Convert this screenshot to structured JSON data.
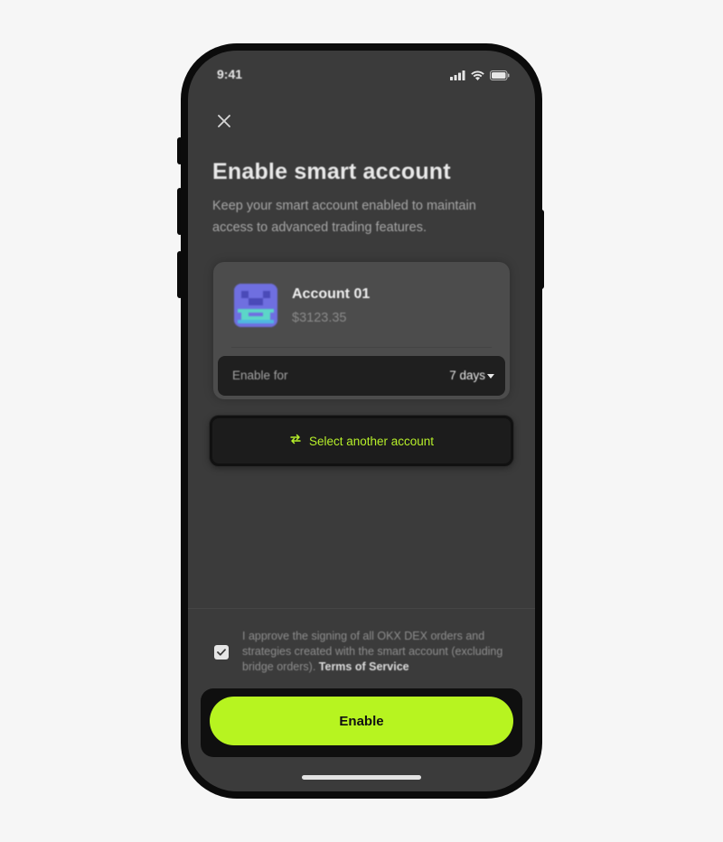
{
  "status_bar": {
    "time": "9:41"
  },
  "header": {
    "title": "Enable smart account",
    "subtitle": "Keep your smart account enabled to maintain access to advanced trading features."
  },
  "account": {
    "name": "Account 01",
    "balance": "$3123.35",
    "enable_for_label": "Enable for",
    "enable_for_value": "7 days"
  },
  "select_another": {
    "label": "Select another account"
  },
  "consent": {
    "checked": true,
    "text": "I approve the signing of all OKX DEX orders and strategies created with the smart account (excluding bridge orders).",
    "terms_label": "Terms of Service"
  },
  "primary_button": {
    "label": "Enable"
  },
  "colors": {
    "accent": "#b7f420",
    "screen_bg": "#3b3b3b",
    "card_bg": "#4c4c4c",
    "dark_field": "#1f1f1f",
    "accent_text": "#b7f02a"
  },
  "icons": {
    "close": "close-icon",
    "swap": "swap-arrows-icon",
    "caret": "chevron-down-icon",
    "check": "check-icon",
    "signal": "cellular-signal-icon",
    "wifi": "wifi-icon",
    "battery": "battery-icon"
  }
}
